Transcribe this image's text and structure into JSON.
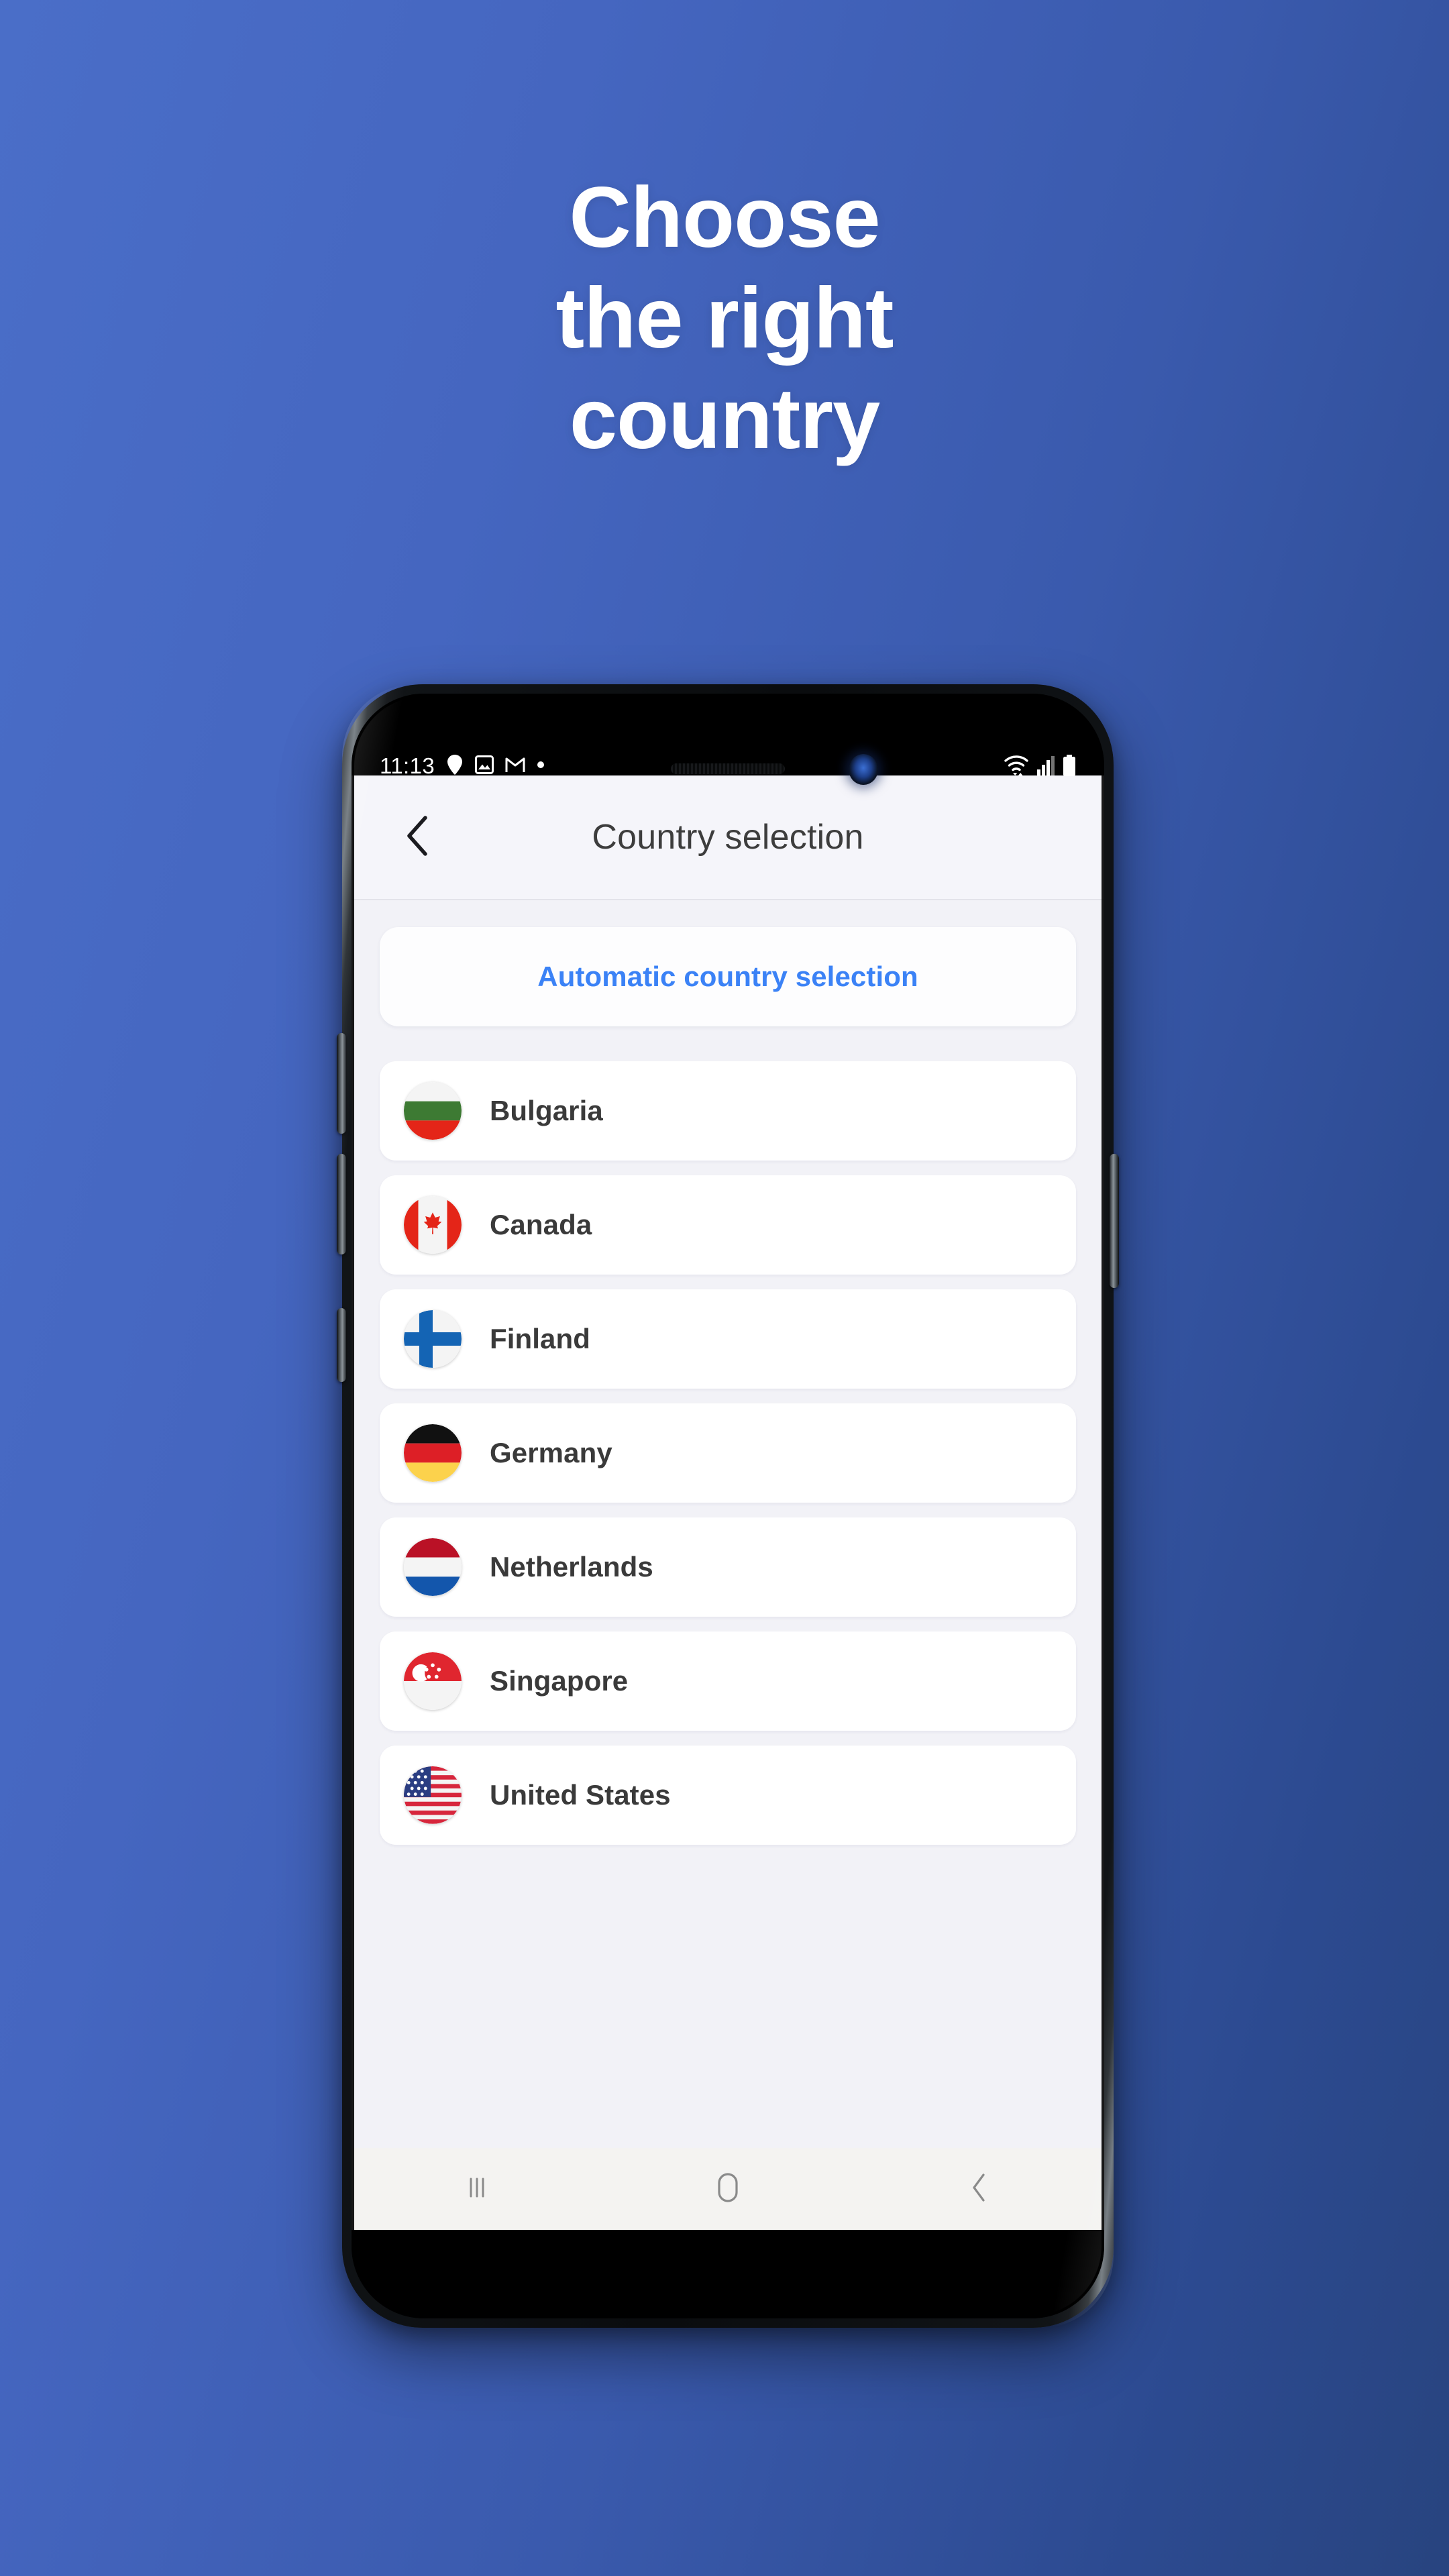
{
  "headline": {
    "lines": [
      "Choose",
      "the right",
      "country"
    ],
    "color": "#ffffff"
  },
  "background": {
    "gradient_from": "#4a6ec8",
    "gradient_to": "#28447f"
  },
  "phone": {
    "status_bar": {
      "time": "11:13",
      "left_icons": [
        "location-pin-icon",
        "photo-icon",
        "gmail-icon",
        "dot-icon"
      ],
      "right_icons": [
        "wifi-icon",
        "cellular-signal-icon",
        "battery-icon"
      ]
    },
    "app_bar": {
      "back_icon": "chevron-left-icon",
      "title": "Country selection"
    },
    "auto_selection": {
      "label": "Automatic country selection",
      "accent_color": "#3b82f6"
    },
    "countries": [
      {
        "name": "Bulgaria",
        "flag": "bulgaria-flag-icon"
      },
      {
        "name": "Canada",
        "flag": "canada-flag-icon"
      },
      {
        "name": "Finland",
        "flag": "finland-flag-icon"
      },
      {
        "name": "Germany",
        "flag": "germany-flag-icon"
      },
      {
        "name": "Netherlands",
        "flag": "netherlands-flag-icon"
      },
      {
        "name": "Singapore",
        "flag": "singapore-flag-icon"
      },
      {
        "name": "United States",
        "flag": "united-states-flag-icon"
      }
    ],
    "nav_bar": {
      "recents_label": "recents-icon",
      "home_label": "home-icon",
      "back_label": "back-icon"
    }
  }
}
